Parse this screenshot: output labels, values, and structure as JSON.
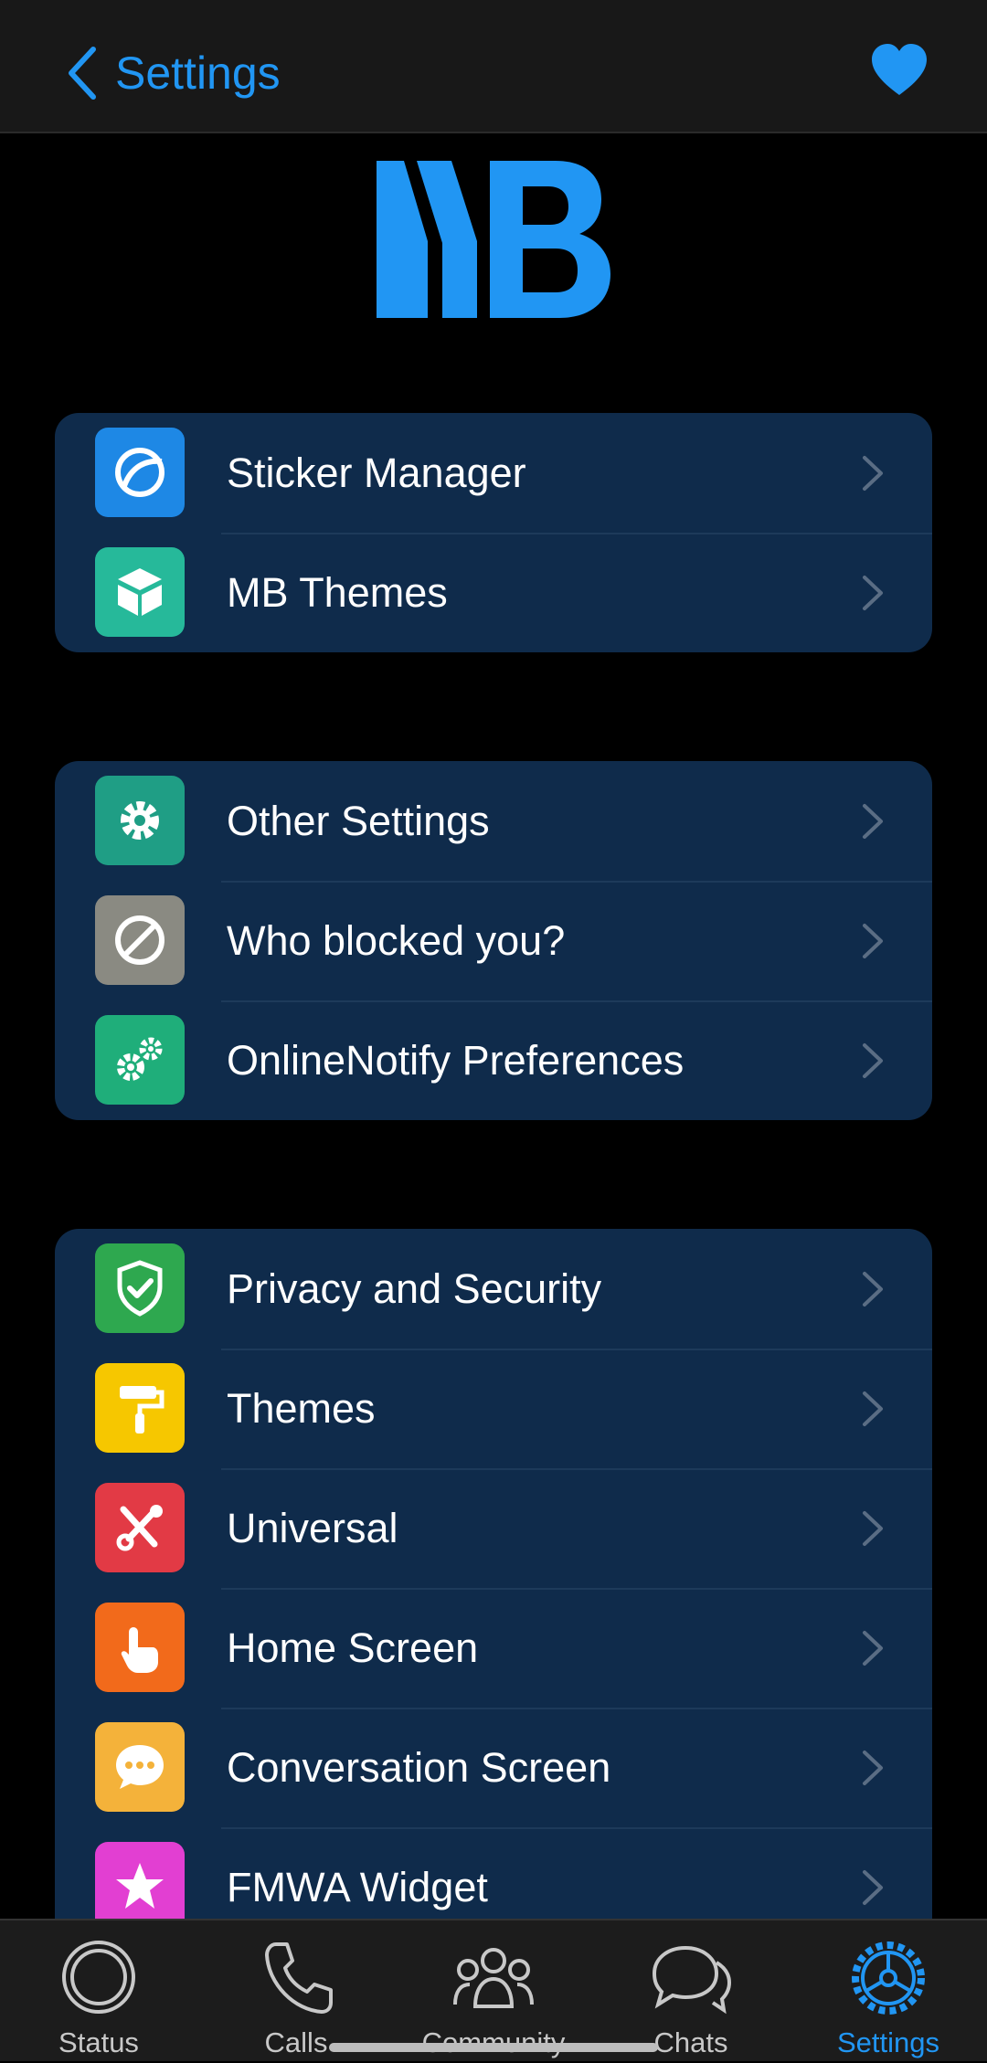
{
  "header": {
    "back_label": "Settings",
    "back_icon": "chevron-left-icon",
    "favorite_icon": "heart-icon",
    "accent": "#2196f3"
  },
  "logo": {
    "text": "MB",
    "color": "#2196f3"
  },
  "groups": [
    {
      "items": [
        {
          "label": "Sticker Manager",
          "icon": "sticker-icon",
          "color": "#1e88e5"
        },
        {
          "label": "MB Themes",
          "icon": "package-icon",
          "color": "#26b99a"
        }
      ]
    },
    {
      "items": [
        {
          "label": "Other Settings",
          "icon": "gear-icon",
          "color": "#1f9e85"
        },
        {
          "label": "Who blocked you?",
          "icon": "blocked-icon",
          "color": "#8a8a82"
        },
        {
          "label": "OnlineNotify Preferences",
          "icon": "gears-icon",
          "color": "#1fae7a"
        }
      ]
    },
    {
      "items": [
        {
          "label": "Privacy and Security",
          "icon": "shield-check-icon",
          "color": "#2ea84f"
        },
        {
          "label": "Themes",
          "icon": "paint-roller-icon",
          "color": "#f6c700"
        },
        {
          "label": "Universal",
          "icon": "tools-icon",
          "color": "#e23a45"
        },
        {
          "label": "Home Screen",
          "icon": "tap-hand-icon",
          "color": "#f26a1b"
        },
        {
          "label": "Conversation Screen",
          "icon": "chat-bubble-icon",
          "color": "#f4b23a"
        },
        {
          "label": "FMWA Widget",
          "icon": "star-icon",
          "color": "#e23fd2"
        }
      ]
    }
  ],
  "tabs": [
    {
      "label": "Status",
      "icon": "status-icon",
      "active": false
    },
    {
      "label": "Calls",
      "icon": "phone-icon",
      "active": false
    },
    {
      "label": "Community",
      "icon": "community-icon",
      "active": false
    },
    {
      "label": "Chats",
      "icon": "chats-icon",
      "active": false
    },
    {
      "label": "Settings",
      "icon": "settings-gear-icon",
      "active": true
    }
  ]
}
